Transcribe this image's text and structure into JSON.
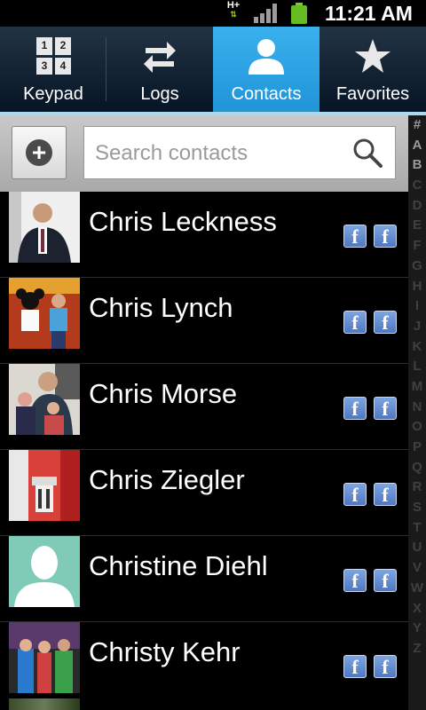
{
  "status_bar": {
    "network": "H+",
    "time": "11:21 AM"
  },
  "tabs": [
    {
      "label": "Keypad",
      "icon": "keypad-icon",
      "active": false,
      "digits": [
        "1",
        "2",
        "3",
        "4"
      ]
    },
    {
      "label": "Logs",
      "icon": "logs-icon",
      "active": false
    },
    {
      "label": "Contacts",
      "icon": "contact-person-icon",
      "active": true
    },
    {
      "label": "Favorites",
      "icon": "star-icon",
      "active": false
    }
  ],
  "search": {
    "placeholder": "Search contacts",
    "value": ""
  },
  "index": [
    "#",
    "A",
    "B",
    "C",
    "D",
    "E",
    "F",
    "G",
    "H",
    "I",
    "J",
    "K",
    "L",
    "M",
    "N",
    "O",
    "P",
    "Q",
    "R",
    "S",
    "T",
    "U",
    "V",
    "W",
    "X",
    "Y",
    "Z"
  ],
  "contacts": [
    {
      "name": "Chris Leckness",
      "photo": "person-photo",
      "source_icons": [
        "facebook-icon",
        "facebook-icon"
      ]
    },
    {
      "name": "Chris Lynch",
      "photo": "person-photo",
      "source_icons": [
        "facebook-icon",
        "facebook-icon"
      ]
    },
    {
      "name": "Chris Morse",
      "photo": "person-photo",
      "source_icons": [
        "facebook-icon",
        "facebook-icon"
      ]
    },
    {
      "name": "Chris Ziegler",
      "photo": "person-photo",
      "source_icons": [
        "facebook-icon",
        "facebook-icon"
      ]
    },
    {
      "name": "Christine Diehl",
      "photo": "default-avatar",
      "source_icons": [
        "facebook-icon",
        "facebook-icon"
      ]
    },
    {
      "name": "Christy Kehr",
      "photo": "person-photo",
      "source_icons": [
        "facebook-icon",
        "facebook-icon"
      ]
    }
  ],
  "colors": {
    "active_tab": "#1f95d8",
    "facebook": "#4f78c2",
    "default_avatar_bg": "#7fcbb8"
  }
}
